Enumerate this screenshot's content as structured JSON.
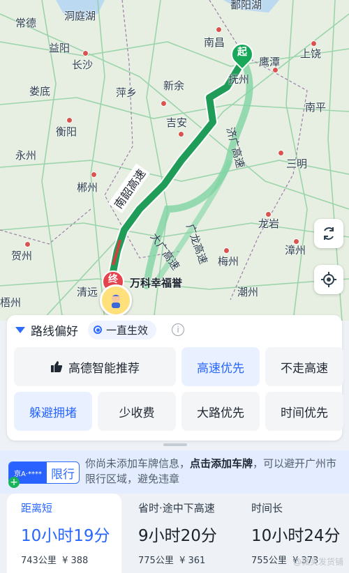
{
  "map": {
    "cities": [
      {
        "name": "鄱阳湖"
      },
      {
        "name": "常德"
      },
      {
        "name": "洞庭湖"
      },
      {
        "name": "南昌"
      },
      {
        "name": "益阳"
      },
      {
        "name": "长沙"
      },
      {
        "name": "鹰潭"
      },
      {
        "name": "上饶"
      },
      {
        "name": "抚州"
      },
      {
        "name": "娄底"
      },
      {
        "name": "萍乡"
      },
      {
        "name": "新余"
      },
      {
        "name": "南平"
      },
      {
        "name": "衡阳"
      },
      {
        "name": "吉安"
      },
      {
        "name": "永州"
      },
      {
        "name": "三明"
      },
      {
        "name": "郴州"
      },
      {
        "name": "龙岩"
      },
      {
        "name": "贺州"
      },
      {
        "name": "梅州"
      },
      {
        "name": "漳州"
      },
      {
        "name": "清远"
      },
      {
        "name": "潮州"
      },
      {
        "name": "梧州"
      }
    ],
    "highways": {
      "main": "南韶高速",
      "alt1": "济广高速",
      "alt2": "大广高速",
      "alt3": "广龙高速"
    },
    "start_marker": "起",
    "end_marker": "终",
    "destination": "万科幸福誉"
  },
  "preference": {
    "title": "路线偏好",
    "sticky": "一直生效",
    "info_icon": "i",
    "options": [
      {
        "label": "高德智能推荐",
        "selected": false,
        "icon": "thumbs-up-icon"
      },
      {
        "label": "高速优先",
        "selected": true
      },
      {
        "label": "不走高速",
        "selected": false
      },
      {
        "label": "躲避拥堵",
        "selected": true
      },
      {
        "label": "少收费",
        "selected": false
      },
      {
        "label": "大路优先",
        "selected": false
      },
      {
        "label": "时间优先",
        "selected": false
      }
    ]
  },
  "notice": {
    "plate": "京A·****",
    "tag": "限行",
    "plus": "+",
    "text_before": "你尚未添加车牌信息，",
    "text_link": "点击添加车牌",
    "text_after": "，可以避开广州市限行区域，避免违章"
  },
  "routes": [
    {
      "label": "距离短",
      "time": "10小时19分",
      "distance": "743公里",
      "toll": "¥ 388",
      "selected": true
    },
    {
      "label": "省时·途中下高速",
      "time": "9小时20分",
      "distance": "775公里",
      "toll": "¥ 361",
      "selected": false
    },
    {
      "label": "时间长",
      "time": "10小时24分",
      "distance": "755公里",
      "toll": "¥ 373",
      "selected": false
    }
  ],
  "watermark": "@微笑发货铺",
  "colors": {
    "accent": "#2866ff",
    "route_main": "#1f9d58",
    "route_alt": "#7fd3a3"
  }
}
